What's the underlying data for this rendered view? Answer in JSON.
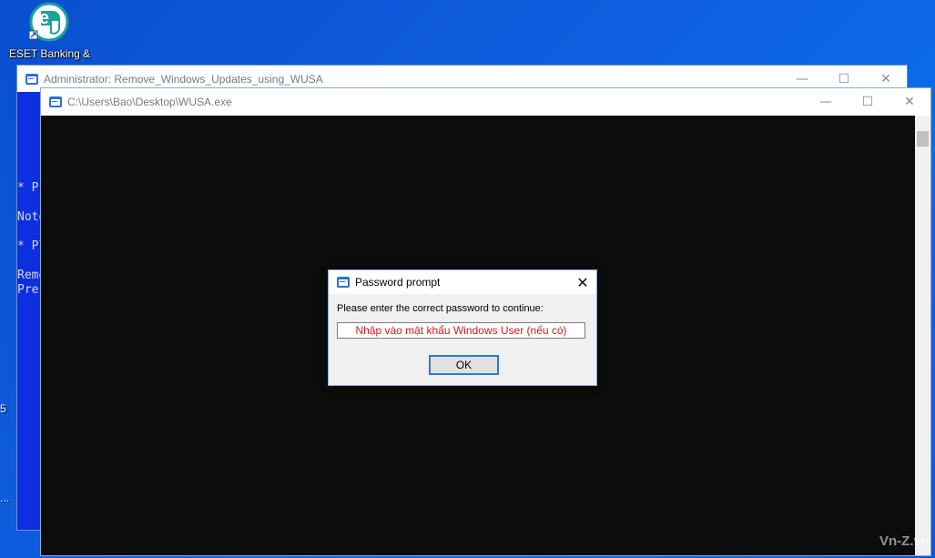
{
  "desktop": {
    "icon_label": "ESET Banking & Payment...",
    "edge_glyphs": [
      "5",
      "..."
    ],
    "watermark": "Vn-Z.vn"
  },
  "back_window": {
    "title": "Administrator:  Remove_Windows_Updates_using_WUSA",
    "lines": [
      "* P",
      "Note",
      "* Pl",
      "Remo",
      "Pres"
    ],
    "controls": {
      "minimize": "—",
      "maximize": "☐",
      "close": "✕"
    }
  },
  "front_window": {
    "title": "C:\\Users\\Bao\\Desktop\\WUSA.exe",
    "controls": {
      "minimize": "—",
      "maximize": "☐",
      "close": "✕"
    }
  },
  "dialog": {
    "title": "Password prompt",
    "message": "Please enter the correct password to continue:",
    "input_value": "Nhập vào mật khẩu Windows User (nếu có)",
    "ok_label": "OK",
    "close_label": "✕"
  },
  "colors": {
    "console_blue": "#0c2fe0",
    "console_black": "#0c0c0c",
    "input_text": "#d41b1b",
    "focus_border": "#2d7ad6"
  }
}
